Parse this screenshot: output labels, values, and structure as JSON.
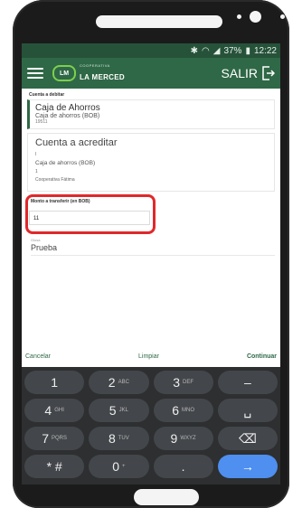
{
  "status_bar": {
    "icons": [
      "bluetooth-icon",
      "wifi-icon",
      "signal-icon"
    ],
    "battery": "37%",
    "time": "12:22"
  },
  "app_bar": {
    "logo_mark": "LM",
    "logo_text": "LA MERCED",
    "logo_sub": "COOPERATIVA",
    "exit_label": "SALIR"
  },
  "debit": {
    "section_label": "Cuenta a debitar",
    "title": "Caja de Ahorros",
    "subtitle": "Caja de ahorros (BOB)",
    "number": "19511"
  },
  "credit": {
    "title": "Cuenta a acreditar",
    "line1": "I",
    "subtitle": "Caja de ahorros (BOB)",
    "line2": "1",
    "bank": "Cooperativa Fátima"
  },
  "amount": {
    "label": "Monto a transferir (en BOB)",
    "value": "11"
  },
  "description": {
    "label": "Glosa",
    "value": "Prueba"
  },
  "actions": {
    "cancel": "Cancelar",
    "clear": "Limpiar",
    "continue": "Continuar"
  },
  "keypad": {
    "keys": [
      {
        "main": "1",
        "sub": ""
      },
      {
        "main": "2",
        "sub": "ABC"
      },
      {
        "main": "3",
        "sub": "DEF"
      },
      {
        "main": "–",
        "sub": ""
      },
      {
        "main": "4",
        "sub": "GHI"
      },
      {
        "main": "5",
        "sub": "JKL"
      },
      {
        "main": "6",
        "sub": "MNO"
      },
      {
        "main": "␣",
        "sub": ""
      },
      {
        "main": "7",
        "sub": "PQRS"
      },
      {
        "main": "8",
        "sub": "TUV"
      },
      {
        "main": "9",
        "sub": "WXYZ"
      },
      {
        "main": "⌫",
        "sub": ""
      },
      {
        "main": "* #",
        "sub": ""
      },
      {
        "main": "0",
        "sub": "+"
      },
      {
        "main": ".",
        "sub": ""
      },
      {
        "main": "→",
        "sub": ""
      }
    ]
  },
  "colors": {
    "brand_green": "#2f6846",
    "highlight_red": "#e0282b",
    "enter_blue": "#4e8fef"
  }
}
